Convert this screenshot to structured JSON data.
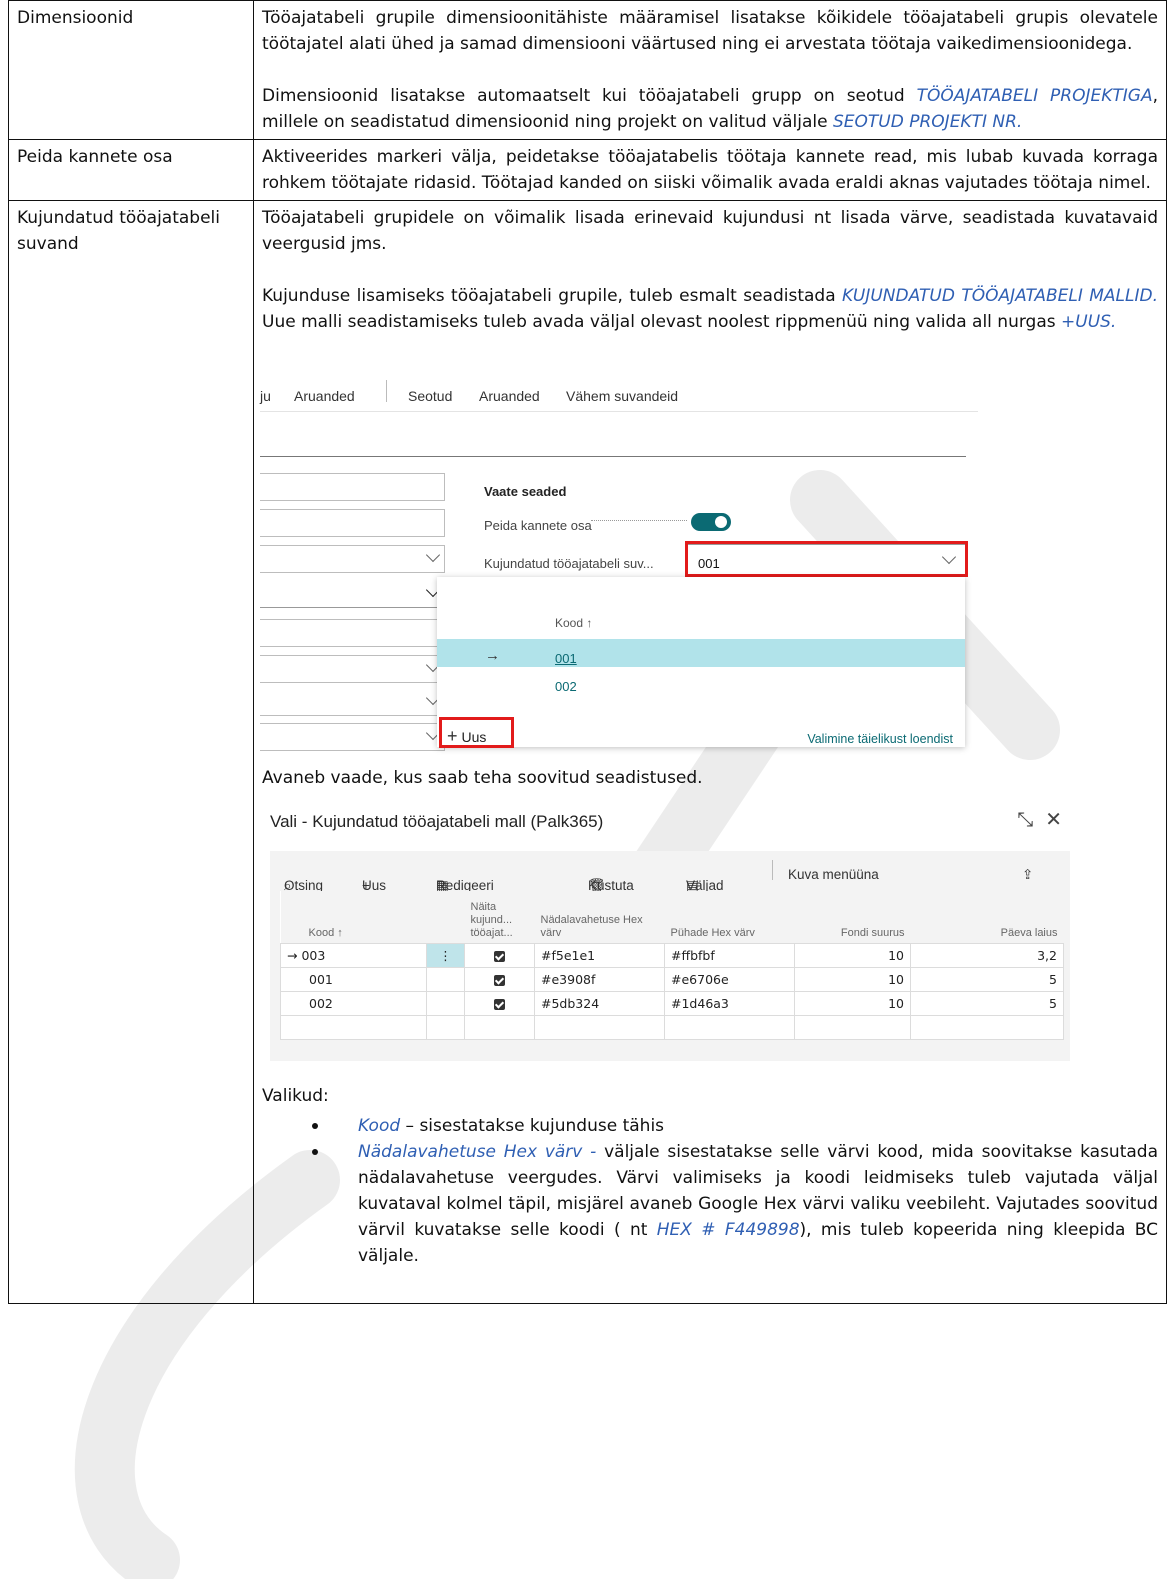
{
  "rows": [
    {
      "label": "Dimensioonid",
      "p1": "Tööajatabeli grupile dimensioonitähiste määramisel lisatakse kõikidele tööajatabeli grupis olevatele töötajatel alati ühed ja samad dimensiooni väärtused ning ei arvestata töötaja vaikedimensioonidega.",
      "p2a": "Dimensioonid lisatakse automaatselt kui tööajatabeli grupp on seotud ",
      "p2_link1": "TÖÖAJATABELI PROJEKTIGA",
      "p2b": ", millele on seadistatud dimensioonid ning projekt on valitud väljale ",
      "p2_link2": "SEOTUD PROJEKTI NR."
    },
    {
      "label": "Peida kannete osa",
      "p1": "Aktiveerides markeri välja, peidetakse tööajatabelis töötaja kannete read, mis lubab kuvada korraga rohkem töötajate ridasid.  Töötajad kanded on siiski võimalik avada eraldi aknas vajutades töötaja nimel."
    },
    {
      "label": "Kujundatud tööajatabeli suvand",
      "p1": "Tööajatabeli grupidele on võimalik lisada erinevaid kujundusi nt lisada värve, seadistada kuvatavaid veergusid jms.",
      "p2a": "Kujunduse lisamiseks tööajatabeli grupile, tuleb esmalt seadistada ",
      "p2_link1": "KUJUNDATUD TÖÖAJATABELI MALLID.",
      "p2b": " Uue malli seadistamiseks tuleb avada väljal olevast noolest rippmenüü ning valida all nurgas ",
      "p2_link2": "+UUS.",
      "after_shot1": "Avaneb vaade, kus saab teha soovitud seadistused.",
      "options_title": "Valikud:",
      "bullets": [
        {
          "term": "Kood",
          "dash": " – ",
          "text": "sisestatakse kujunduse tähis"
        },
        {
          "term": "Nädalavahetuse Hex värv",
          "dash": " - ",
          "text": "väljale sisestatakse selle värvi kood, mida soovitakse kasutada nädalavahetuse veergudes. Värvi valimiseks ja koodi leidmiseks tuleb vajutada väljal kuvataval kolmel täpil, misjärel avaneb Google Hex värvi valiku veebileht. Vajutades soovitud värvil kuvatakse selle koodi ( nt ",
          "example": "HEX # F449898",
          "text_end": "), mis tuleb kopeerida ning kleepida BC väljale."
        }
      ]
    }
  ],
  "shot1": {
    "nav": [
      "ju",
      "Aruanded",
      "Seotud",
      "Aruanded",
      "Vähem suvandeid"
    ],
    "section_title": "Vaate seaded",
    "toggle_label": "Peida kannete osa",
    "combo_label": "Kujundatud tööajatabeli suv...",
    "combo_value": "001",
    "drop_header": "Kood ↑",
    "drop_rows": [
      "001",
      "002"
    ],
    "new_label": "Uus",
    "full_list": "Valimine täielikust loendist"
  },
  "shot2": {
    "title": "Vali - Kujundatud tööajatabeli mall (Palk365)",
    "toolbar": [
      "Otsing",
      "Uus",
      "Redigeeri loendit",
      "Kustuta",
      "Väljad",
      "Kuva menüüna"
    ],
    "headers": [
      "Kood ↑",
      "",
      "Näita kujund... tööajat...",
      "Nädalavahetuse Hex värv",
      "Pühade Hex värv",
      "Fondi suurus",
      "Päeva laius"
    ],
    "rows": [
      {
        "code": "003",
        "weekend": "#f5e1e1",
        "holiday": "#ffbfbf",
        "font": "10",
        "width": "3,2"
      },
      {
        "code": "001",
        "weekend": "#e3908f",
        "holiday": "#e6706e",
        "font": "10",
        "width": "5"
      },
      {
        "code": "002",
        "weekend": "#5db324",
        "holiday": "#1d46a3",
        "font": "10",
        "width": "5"
      }
    ]
  },
  "colors": {
    "link": "#2f5fb3",
    "teal": "#0b6a73",
    "highlight": "#e21b1b"
  }
}
